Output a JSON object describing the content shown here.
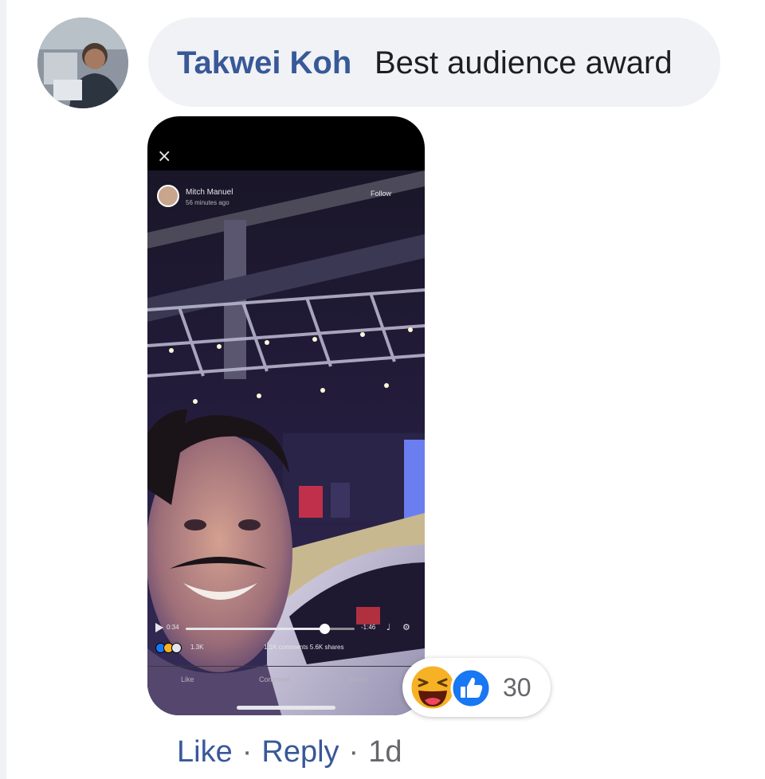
{
  "comment": {
    "author": "Takwei Koh",
    "text": "Best audience award",
    "avatar_icon": "user-avatar"
  },
  "attachment": {
    "type": "video-screenshot",
    "close_icon": "×",
    "poster_name": "Mitch Manuel",
    "poster_time": "56 minutes ago",
    "follow_label": "Follow",
    "time_elapsed": "0:34",
    "time_remaining": "-1:46",
    "progress": 0.82,
    "reaction_count": "1.3K",
    "engagement": "1.1K comments  5.6K shares",
    "actions": [
      "Like",
      "Comment",
      "Share"
    ]
  },
  "reactions": {
    "icons": [
      "haha-icon",
      "like-icon"
    ],
    "count": "30",
    "colors": {
      "haha": "#f7b125",
      "like": "#1877f2"
    }
  },
  "meta": {
    "like_label": "Like",
    "reply_label": "Reply",
    "separator": "·",
    "age": "1d"
  },
  "colors": {
    "author": "#385898",
    "bubble": "#f0f2f5",
    "text": "#1c1e21",
    "muted": "#65676b"
  }
}
